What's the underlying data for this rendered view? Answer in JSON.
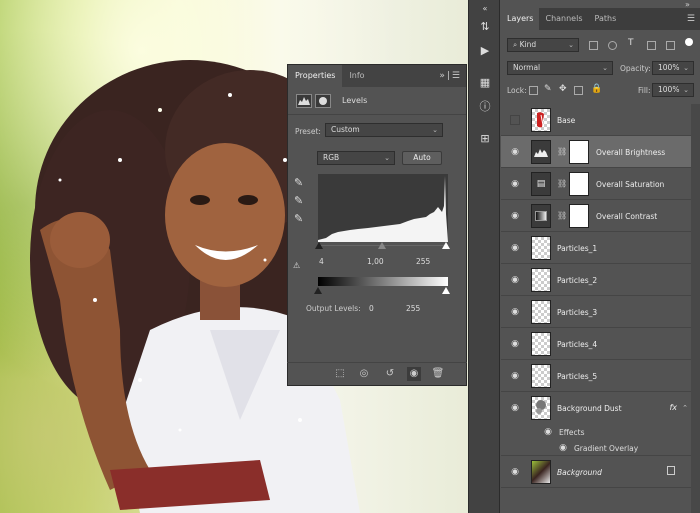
{
  "properties_panel": {
    "tabs": [
      "Properties",
      "Info"
    ],
    "title": "Levels",
    "preset_label": "Preset:",
    "preset_value": "Custom",
    "channel_value": "RGB",
    "auto_label": "Auto",
    "input_levels": [
      "4",
      "1,00",
      "255"
    ],
    "output_label": "Output Levels:",
    "output_levels": [
      "0",
      "255"
    ]
  },
  "layers_panel": {
    "tabs": [
      "Layers",
      "Channels",
      "Paths"
    ],
    "filter_label": "Kind",
    "blend_mode": "Normal",
    "opacity_label": "Opacity:",
    "opacity_value": "100%",
    "lock_label": "Lock:",
    "fill_label": "Fill:",
    "fill_value": "100%",
    "layers": [
      {
        "name": "Base",
        "visible": false,
        "thumb": "base"
      },
      {
        "name": "Overall Brightness",
        "visible": true,
        "thumb": "levels",
        "mask": true,
        "selected": true
      },
      {
        "name": "Overall Saturation",
        "visible": true,
        "thumb": "hue",
        "mask": true
      },
      {
        "name": "Overall Contrast",
        "visible": true,
        "thumb": "gradient",
        "mask": true
      },
      {
        "name": "Particles_1",
        "visible": true,
        "thumb": "transparent"
      },
      {
        "name": "Particles_2",
        "visible": true,
        "thumb": "transparent"
      },
      {
        "name": "Particles_3",
        "visible": true,
        "thumb": "transparent"
      },
      {
        "name": "Particles_4",
        "visible": true,
        "thumb": "transparent"
      },
      {
        "name": "Particles_5",
        "visible": true,
        "thumb": "transparent"
      },
      {
        "name": "Background Dust",
        "visible": true,
        "thumb": "dust",
        "fx": "fx"
      },
      {
        "name": "Background",
        "visible": true,
        "thumb": "photo",
        "locked": true
      }
    ],
    "effects_label": "Effects",
    "effect_item": "Gradient Overlay"
  },
  "colors": {
    "panel_bg": "#535353",
    "selected_row": "#6b6b6b",
    "tab_bar": "#3d3d3d"
  }
}
